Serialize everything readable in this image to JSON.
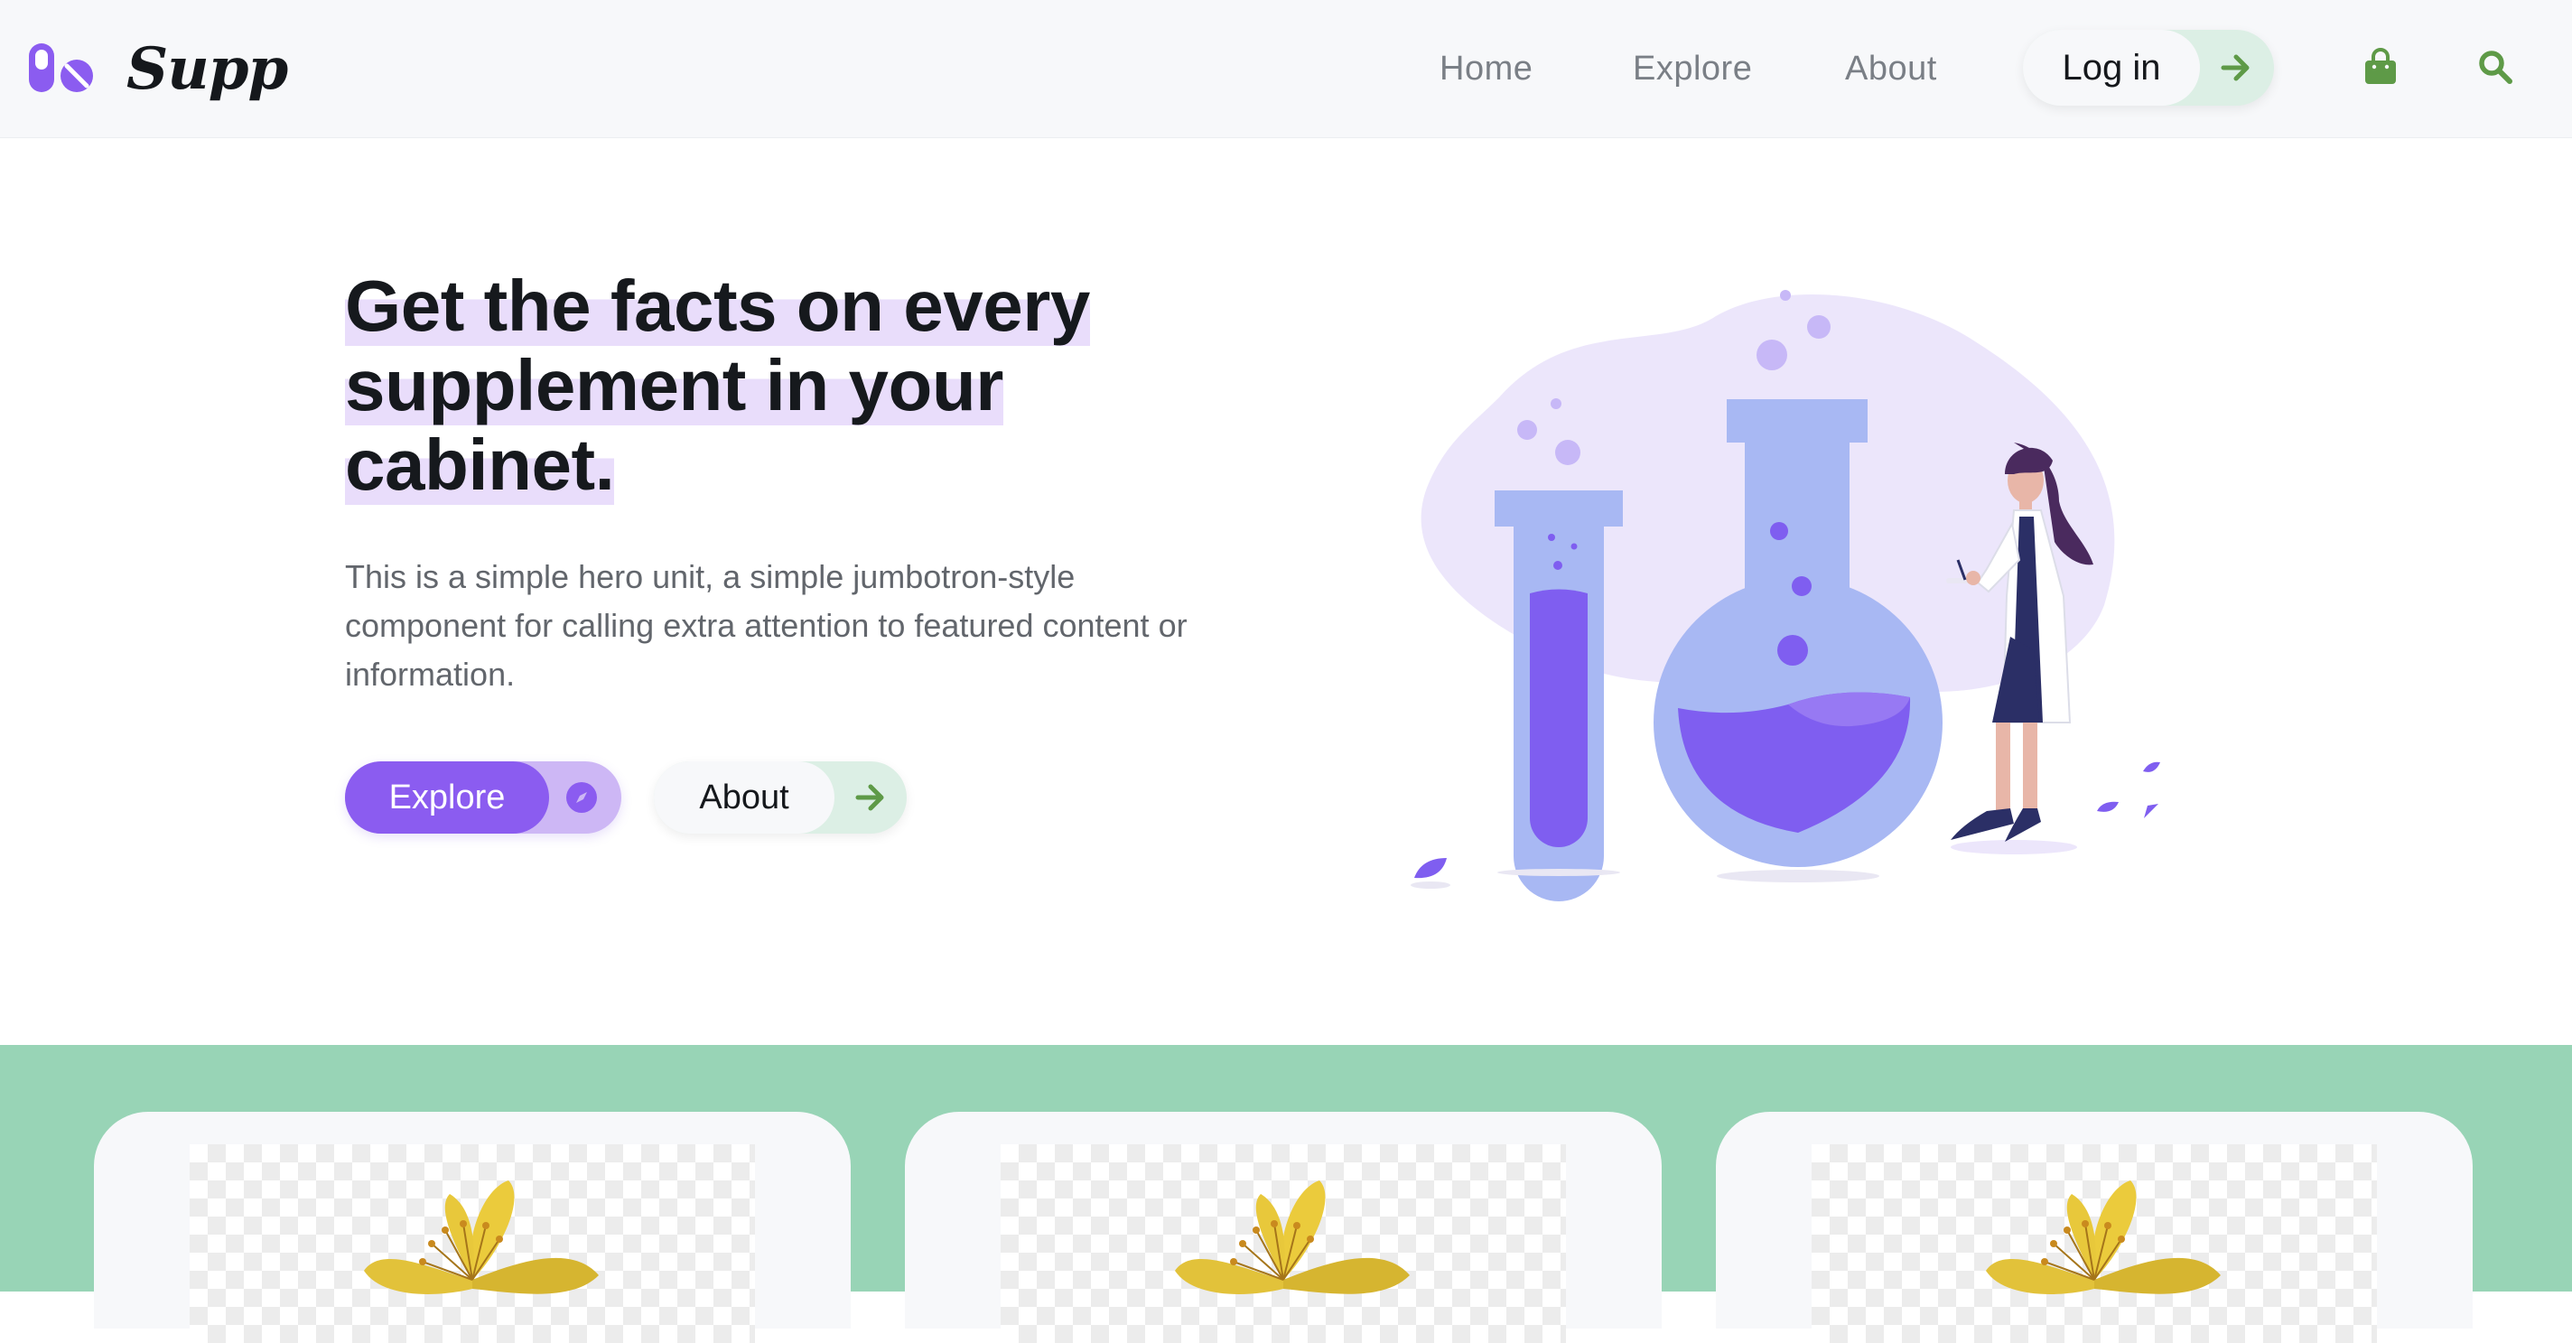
{
  "brand": {
    "name": "Supp"
  },
  "nav": {
    "links": [
      "Home",
      "Explore",
      "About"
    ],
    "login_label": "Log in",
    "icons": [
      "shopping-bag-icon",
      "search-icon"
    ]
  },
  "hero": {
    "title": "Get the facts on every supplement in your cabinet.",
    "lead": "This is a simple hero unit, a simple jumbotron-style component for calling extra attention to featured content or information.",
    "buttons": {
      "explore": "Explore",
      "about": "About"
    }
  },
  "colors": {
    "accent_purple": "#8b5cf0",
    "accent_green": "#5e9a47",
    "strip_green": "#98d4b6",
    "highlight": "#e9ddfb"
  },
  "features": {
    "cards": [
      {
        "image": "flower-image"
      },
      {
        "image": "flower-image"
      },
      {
        "image": "flower-image"
      }
    ]
  }
}
